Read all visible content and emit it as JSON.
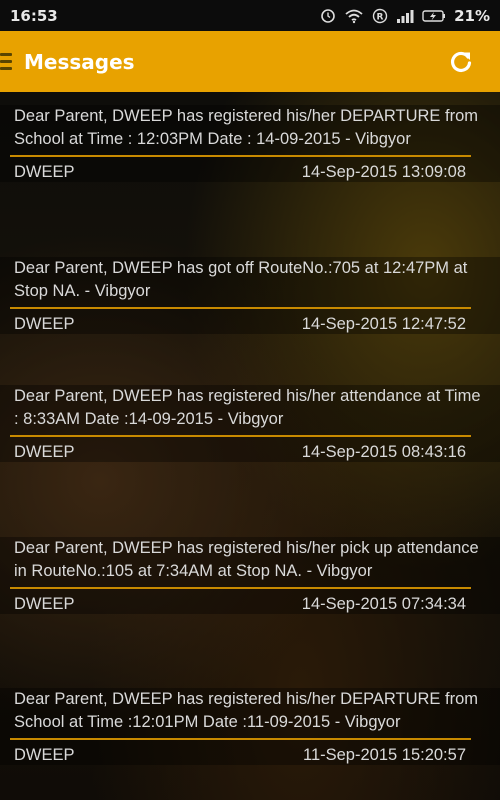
{
  "status_bar": {
    "time": "16:53",
    "battery": "21%"
  },
  "app_bar": {
    "title": "Messages",
    "accent_color": "#E8A200"
  },
  "messages": [
    {
      "text": "Dear Parent, DWEEP has registered his/her DEPARTURE from School at Time : 12:03PM Date : 14-09-2015 - Vibgyor",
      "sender": "DWEEP",
      "timestamp": "14-Sep-2015 13:09:08"
    },
    {
      "text": "Dear Parent, DWEEP has got off RouteNo.:705 at 12:47PM at Stop NA. - Vibgyor",
      "sender": "DWEEP",
      "timestamp": "14-Sep-2015 12:47:52"
    },
    {
      "text": "Dear Parent, DWEEP has registered his/her attendance at Time : 8:33AM Date :14-09-2015 - Vibgyor",
      "sender": "DWEEP",
      "timestamp": "14-Sep-2015 08:43:16"
    },
    {
      "text": "Dear Parent, DWEEP has registered his/her pick up attendance in RouteNo.:105 at  7:34AM at Stop NA. - Vibgyor",
      "sender": "DWEEP",
      "timestamp": "14-Sep-2015 07:34:34"
    },
    {
      "text": "Dear Parent, DWEEP has registered his/her DEPARTURE from School at Time :12:01PM Date :11-09-2015 - Vibgyor",
      "sender": "DWEEP",
      "timestamp": "11-Sep-2015 15:20:57"
    }
  ]
}
